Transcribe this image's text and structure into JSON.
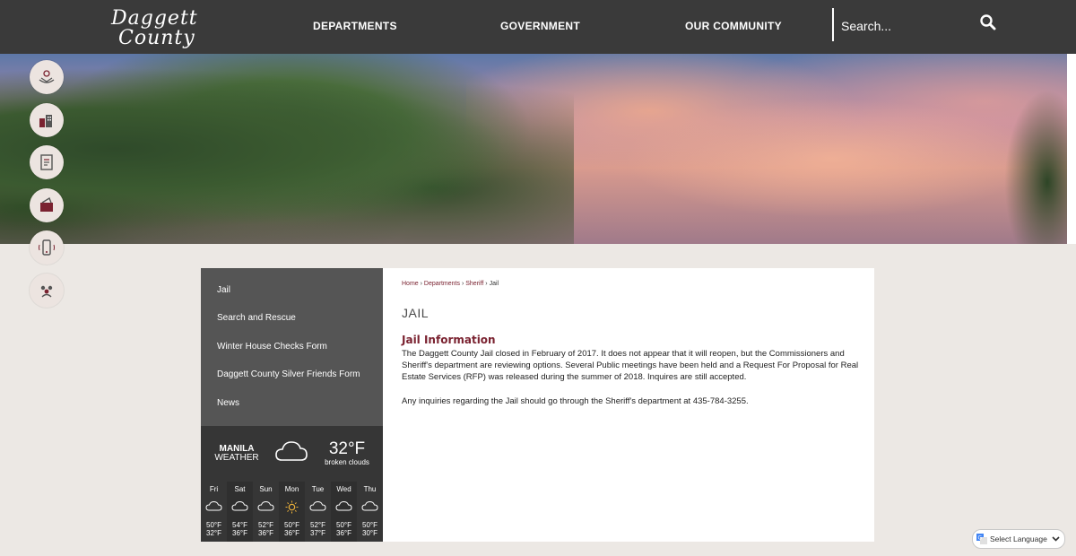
{
  "header": {
    "logo_line1": "Daggett",
    "logo_line2": "County",
    "nav": [
      "DEPARTMENTS",
      "GOVERNMENT",
      "OUR COMMUNITY"
    ],
    "search_placeholder": "Search...",
    "search_icon": "search-icon"
  },
  "side_icons": [
    "hands-icon",
    "buildings-icon",
    "document-icon",
    "mailbox-icon",
    "phone-icon",
    "people-icon"
  ],
  "sidebar": {
    "items": [
      "Jail",
      "Search and Rescue",
      "Winter House Checks Form",
      "Daggett County Silver Friends Form",
      "News"
    ]
  },
  "weather": {
    "location": "MANILA",
    "label": "WEATHER",
    "temp": "32°F",
    "condition": "broken clouds",
    "forecast": [
      {
        "day": "Fri",
        "hi": "50°F",
        "lo": "32°F",
        "icon": "cloud-icon"
      },
      {
        "day": "Sat",
        "hi": "54°F",
        "lo": "36°F",
        "icon": "cloud-icon"
      },
      {
        "day": "Sun",
        "hi": "52°F",
        "lo": "36°F",
        "icon": "cloud-icon"
      },
      {
        "day": "Mon",
        "hi": "50°F",
        "lo": "36°F",
        "icon": "sun-icon"
      },
      {
        "day": "Tue",
        "hi": "52°F",
        "lo": "37°F",
        "icon": "cloud-icon"
      },
      {
        "day": "Wed",
        "hi": "50°F",
        "lo": "36°F",
        "icon": "cloud-icon"
      },
      {
        "day": "Thu",
        "hi": "50°F",
        "lo": "30°F",
        "icon": "cloud-icon"
      }
    ]
  },
  "content": {
    "breadcrumb": [
      "Home",
      "Departments",
      "Sheriff",
      "Jail"
    ],
    "title": "JAIL",
    "section_title": "Jail Information",
    "paragraph1": "The Daggett County Jail closed in February of 2017.  It does not appear that it will reopen, but the Commissioners and Sheriff's department are reviewing options.  Several Public meetings have been held and a Request For Proposal for Real Estate Services (RFP) was released  during the summer of 2018. Inquires are still accepted.",
    "paragraph2": "Any inquiries regarding the Jail should go through the Sheriff's department at 435-784-3255."
  },
  "translate": {
    "label": "Select Language"
  },
  "colors": {
    "header_bg": "#3a3a3a",
    "accent": "#7a2230",
    "sidebar_bg": "#555555",
    "weather_bg": "#363636",
    "page_bg": "#ece8e4"
  }
}
